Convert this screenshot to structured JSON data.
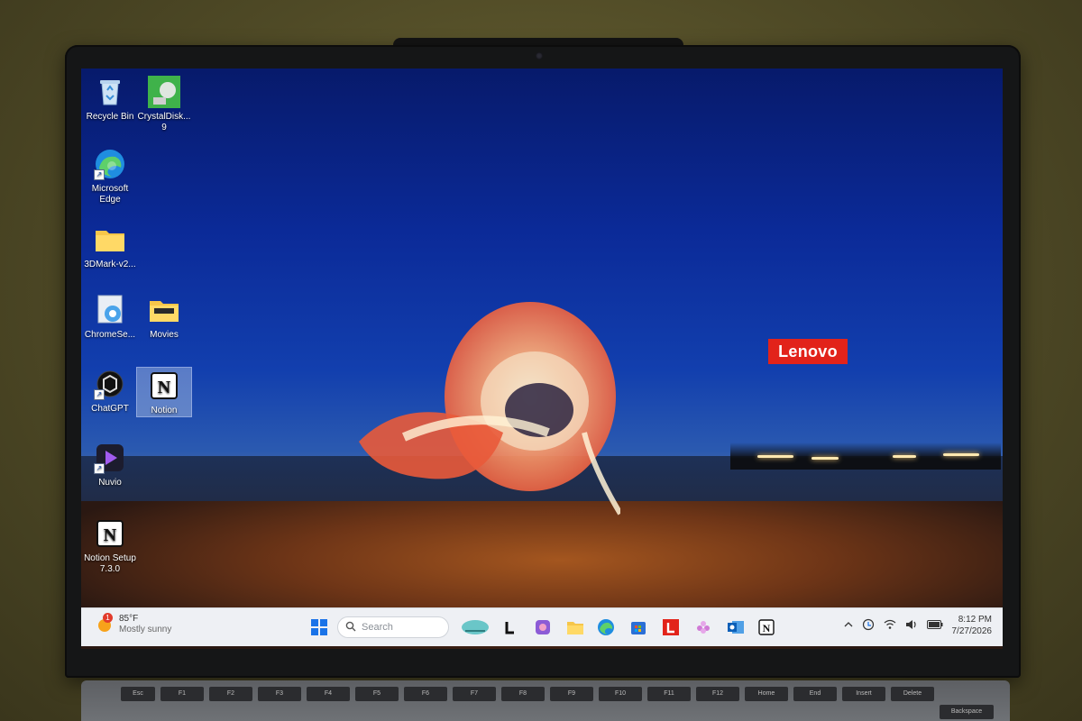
{
  "desktop": {
    "icons": [
      {
        "label": "Recycle Bin",
        "icon": "recycle-bin-icon"
      },
      {
        "label": "CrystalDisk... 9",
        "icon": "crystaldisk-icon"
      },
      {
        "label": "Microsoft Edge",
        "icon": "edge-icon"
      },
      {
        "label": "3DMark-v2...",
        "icon": "folder-icon"
      },
      {
        "label": "ChromeSe...",
        "icon": "chrome-setup-icon"
      },
      {
        "label": "Movies",
        "icon": "folder-icon"
      },
      {
        "label": "ChatGPT",
        "icon": "chatgpt-icon"
      },
      {
        "label": "Notion",
        "icon": "notion-icon"
      },
      {
        "label": "Nuvio",
        "icon": "nuvio-icon"
      },
      {
        "label": "Notion Setup 7.3.0",
        "icon": "notion-setup-icon"
      }
    ],
    "wallpaper_brand": "Lenovo"
  },
  "taskbar": {
    "weather": {
      "temp": "85°F",
      "condition": "Mostly sunny",
      "badge": "1"
    },
    "search_placeholder": "Search",
    "clock": {
      "time": "8:12 PM",
      "date": "7/27/2026"
    },
    "colors": {
      "taskbar_bg": "#eef0f4",
      "lenovo_red": "#e2231a",
      "accent_blue": "#1a73e8"
    }
  },
  "keyboard": {
    "keys": [
      "Esc",
      "F1",
      "F2",
      "F3",
      "F4",
      "F5",
      "F6",
      "F7",
      "F8",
      "F9",
      "F10",
      "F11",
      "F12",
      "Home",
      "End",
      "Insert",
      "Delete",
      "Backspace"
    ]
  }
}
